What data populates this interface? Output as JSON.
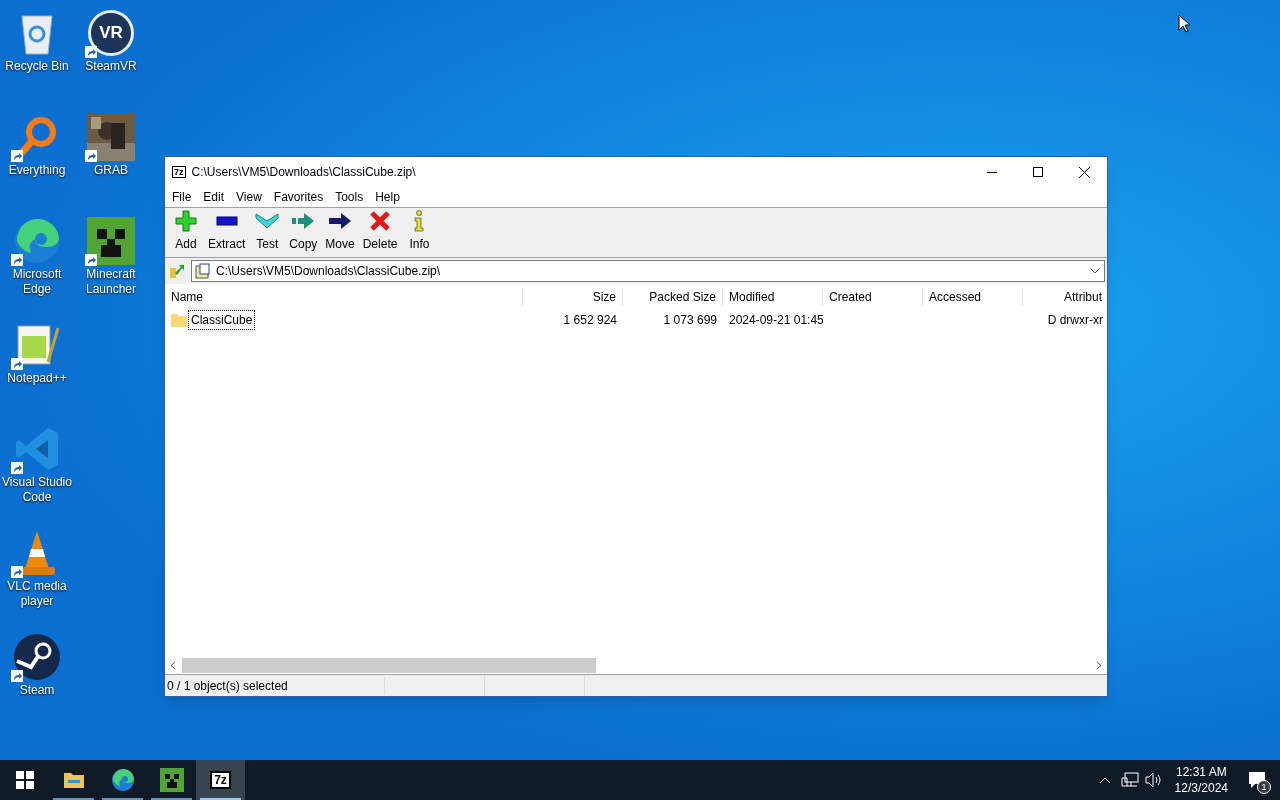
{
  "desktop": {
    "columns": [
      [
        {
          "label": "Recycle Bin",
          "kind": "recycle",
          "shortcut": false
        },
        {
          "label": "Everything",
          "kind": "everything",
          "shortcut": true
        },
        {
          "label": "Microsoft Edge",
          "kind": "edge",
          "shortcut": true
        },
        {
          "label": "Notepad++",
          "kind": "notepad",
          "shortcut": true
        },
        {
          "label": "Visual Studio Code",
          "kind": "vscode",
          "shortcut": true
        },
        {
          "label": "VLC media player",
          "kind": "vlc",
          "shortcut": true
        },
        {
          "label": "Steam",
          "kind": "steam",
          "shortcut": true
        }
      ],
      [
        {
          "label": "SteamVR",
          "kind": "vr",
          "badge": "VR",
          "shortcut": true
        },
        {
          "label": "GRAB",
          "kind": "picture",
          "shortcut": true
        },
        {
          "label": "Minecraft Launcher",
          "kind": "creeper",
          "shortcut": true
        }
      ]
    ]
  },
  "window": {
    "title": "C:\\Users\\VM5\\Downloads\\ClassiCube.zip\\",
    "app_icon": "7z",
    "menu": [
      "File",
      "Edit",
      "View",
      "Favorites",
      "Tools",
      "Help"
    ],
    "toolbar": [
      {
        "label": "Add",
        "kind": "add"
      },
      {
        "label": "Extract",
        "kind": "extract"
      },
      {
        "label": "Test",
        "kind": "test"
      },
      {
        "label": "Copy",
        "kind": "copy"
      },
      {
        "label": "Move",
        "kind": "move"
      },
      {
        "label": "Delete",
        "kind": "delete"
      },
      {
        "label": "Info",
        "kind": "info"
      }
    ],
    "address": "C:\\Users\\VM5\\Downloads\\ClassiCube.zip\\",
    "table": {
      "columns": [
        {
          "label": "Name"
        },
        {
          "label": "Size"
        },
        {
          "label": "Packed Size"
        },
        {
          "label": "Modified"
        },
        {
          "label": "Created"
        },
        {
          "label": "Accessed"
        },
        {
          "label": "Attribut"
        }
      ],
      "rows": [
        {
          "cells": [
            "ClassiCube",
            "1 652 924",
            "1 073 699",
            "2024-09-21 01:45",
            "",
            "",
            "D drwxr-xr"
          ],
          "focused": true,
          "selected": false
        }
      ]
    },
    "status_bar": "0 / 1 object(s) selected"
  },
  "taskbar": {
    "items": [
      {
        "kind": "start",
        "selected": false
      },
      {
        "kind": "explorer",
        "selected": false
      },
      {
        "kind": "edge",
        "selected": false
      },
      {
        "kind": "creeper",
        "selected": false
      },
      {
        "kind": "sevenzip",
        "label": "7z",
        "selected": true
      }
    ],
    "time": "12:31 AM",
    "date": "12/3/2024",
    "notifications": "1"
  }
}
